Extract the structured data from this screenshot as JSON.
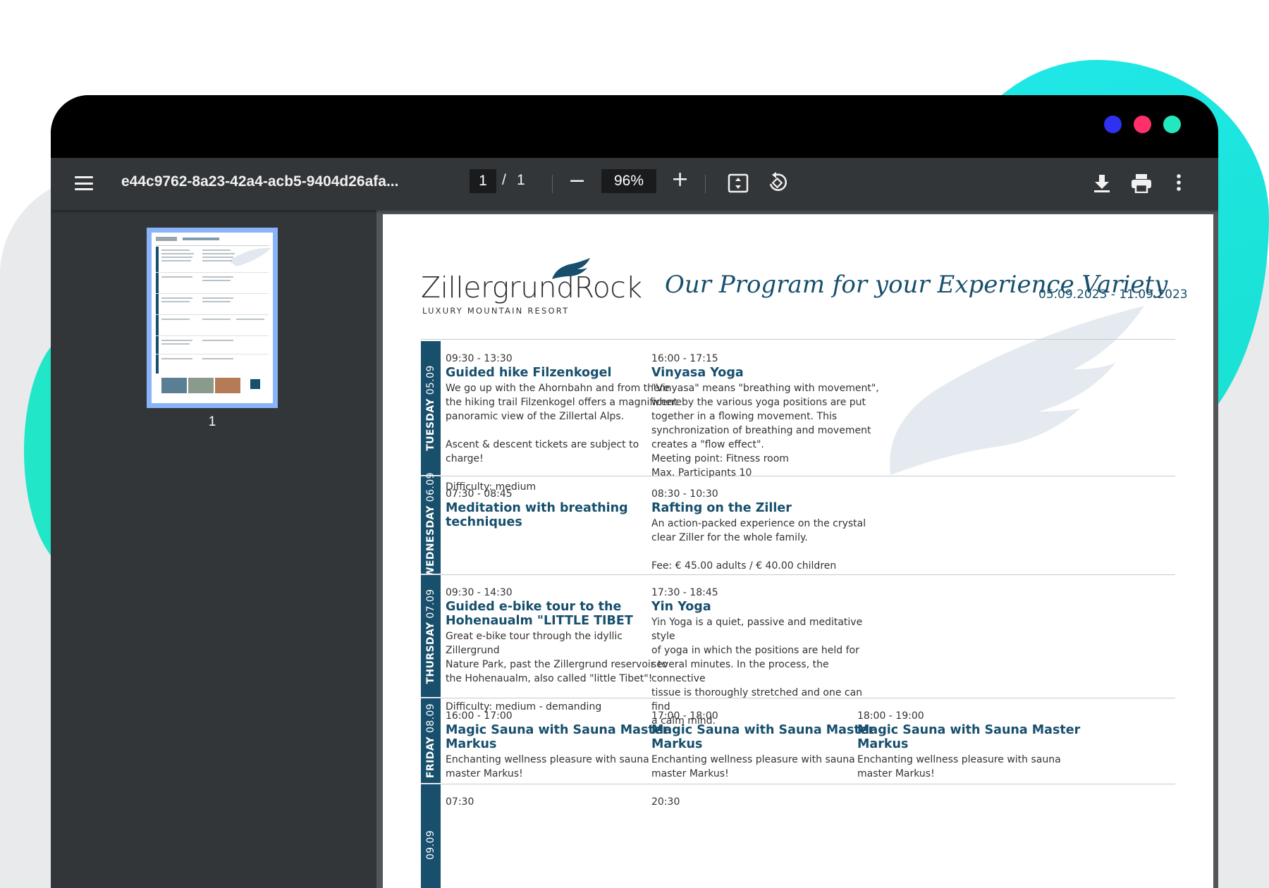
{
  "window": {
    "dots": [
      {
        "name": "blue-dot",
        "color": "#2f31f0"
      },
      {
        "name": "pink-dot",
        "color": "#ff2f6c"
      },
      {
        "name": "teal-dot",
        "color": "#23e8bf"
      }
    ]
  },
  "toolbar": {
    "menu_icon": "hamburger-menu-icon",
    "title": "e44c9762-8a23-42a4-acb5-9404d26afa...",
    "page_current": "1",
    "page_separator": "/",
    "page_total": "1",
    "zoom_out": "−",
    "zoom_level": "96%",
    "zoom_in": "+",
    "icons": [
      "fit-page-icon",
      "rotate-icon",
      "download-icon",
      "print-icon",
      "more-vert-icon"
    ]
  },
  "sidebar": {
    "thumbnail_label": "1"
  },
  "document": {
    "logo_word": "Zillergrund",
    "logo_rock": "Rock",
    "logo_sub": "LUXURY MOUNTAIN RESORT",
    "tagline": "Our Program for your Experience Variety",
    "date_range": "05.09.2023 - 11.09.2023",
    "accent": "#174f6d",
    "days": [
      {
        "name": "TUESDAY",
        "date": "05.09",
        "events": [
          {
            "time": "09:30 - 13:30",
            "title": "Guided hike Filzenkogel",
            "lines": [
              "We go up with the Ahornbahn and from there",
              "the hiking trail Filzenkogel offers a magnificent",
              "panoramic view of the Zillertal Alps.",
              "",
              "Ascent & descent tickets are subject to charge!",
              "",
              "Difficulty: medium"
            ]
          },
          {
            "time": "16:00 - 17:15",
            "title": "Vinyasa Yoga",
            "lines": [
              "\"Vinyasa\" means \"breathing with movement\",",
              "whereby the various yoga positions are put",
              "together in a flowing movement. This",
              "synchronization of breathing and movement",
              "creates a \"flow effect\".",
              "Meeting point: Fitness room",
              "Max. Participants 10"
            ]
          }
        ]
      },
      {
        "name": "WEDNESDAY",
        "date": "06.09",
        "events": [
          {
            "time": "07:30 - 08:45",
            "title": "Meditation with breathing techniques",
            "lines": []
          },
          {
            "time": "08:30 - 10:30",
            "title": "Rafting on the Ziller",
            "lines": [
              "An action-packed experience on the crystal",
              "clear Ziller for the whole family.",
              "",
              "Fee: € 45.00 adults / € 40.00 children"
            ]
          }
        ]
      },
      {
        "name": "THURSDAY",
        "date": "07.09",
        "events": [
          {
            "time": "09:30 - 14:30",
            "title": "Guided e-bike tour to the Hohenaualm \"LITTLE TIBET",
            "lines": [
              "Great e-bike tour through the idyllic Zillergrund",
              "Nature Park, past the Zillergrund reservoir to",
              "the Hohenaualm, also called \"little Tibet\"!",
              "",
              "Difficulty: medium - demanding"
            ]
          },
          {
            "time": "17:30 - 18:45",
            "title": "Yin Yoga",
            "lines": [
              "Yin Yoga is a quiet, passive and meditative style",
              "of yoga in which the positions are held for",
              "several minutes. In the process, the connective",
              "tissue is thoroughly stretched and one can find",
              "a calm mind."
            ]
          }
        ]
      },
      {
        "name": "FRIDAY",
        "date": "08.09",
        "events": [
          {
            "time": "16:00 - 17:00",
            "title": "Magic Sauna with Sauna Master Markus",
            "lines": [
              "Enchanting wellness pleasure with sauna",
              "master Markus!"
            ]
          },
          {
            "time": "17:00 - 18:00",
            "title": "Magic Sauna with Sauna Master Markus",
            "lines": [
              "Enchanting wellness pleasure with sauna",
              "master Markus!"
            ]
          },
          {
            "time": "18:00 - 19:00",
            "title": "Magic Sauna with Sauna Master Markus",
            "lines": [
              "Enchanting wellness pleasure with sauna",
              "master Markus!"
            ]
          }
        ]
      },
      {
        "name": "",
        "date": "09.09",
        "events": [
          {
            "time": "07:30",
            "title": "",
            "lines": []
          },
          {
            "time": "20:30",
            "title": "",
            "lines": []
          }
        ]
      }
    ]
  }
}
